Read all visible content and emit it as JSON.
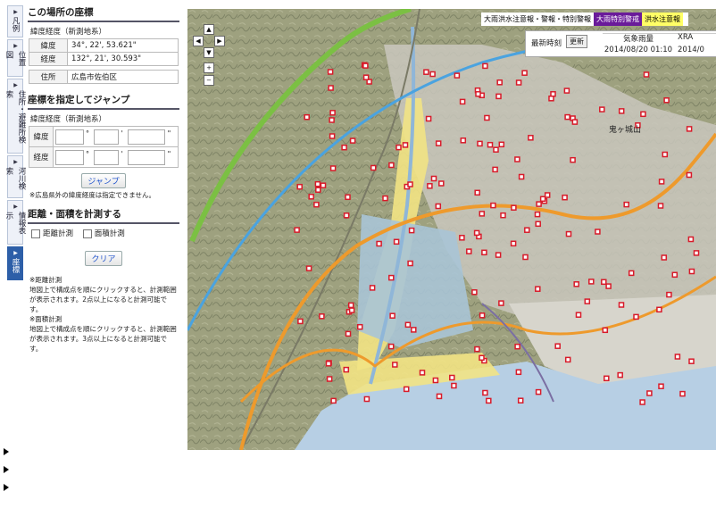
{
  "tabs": [
    {
      "label": "凡例"
    },
    {
      "label": "位置図"
    },
    {
      "label": "住所・避難所検索"
    },
    {
      "label": "河川検索"
    },
    {
      "label": "情報表示"
    },
    {
      "label": "座標"
    }
  ],
  "coord": {
    "title": "この場所の座標",
    "sub": "緯度経度（新測地系）",
    "lat_label": "緯度",
    "lat_value": "34°, 22', 53.621\"",
    "lon_label": "経度",
    "lon_value": "132°, 21', 30.593\"",
    "addr_label": "住所",
    "addr_value": "広島市佐伯区"
  },
  "jump": {
    "title": "座標を指定してジャンプ",
    "sub": "緯度経度（新測地系）",
    "lat_label": "緯度",
    "lon_label": "経度",
    "deg": "°",
    "min": "'",
    "sec": "\"",
    "button": "ジャンプ",
    "note": "※広島県外の緯度経度は指定できません。"
  },
  "measure": {
    "title": "距離・面積を計測する",
    "dist_label": "距離計測",
    "area_label": "面積計測",
    "clear": "クリア",
    "note1_title": "※距離計測",
    "note1": "地図上で構成点を順にクリックすると、計測範囲が表示されます。2点以上になると計測可能です。",
    "note2_title": "※面積計測",
    "note2": "地図上で構成点を順にクリックすると、計測範囲が表示されます。3点以上になると計測可能です。"
  },
  "map": {
    "nav": {
      "up": "▲",
      "left": "◀",
      "right": "▶",
      "down": "▼",
      "zoom_in": "+",
      "zoom_out": "−"
    },
    "legend": [
      {
        "label": "大雨洪水注意報・警報・特別警報",
        "bg": "#ffffff",
        "fg": "#000000"
      },
      {
        "label": "大雨特別警戒",
        "bg": "#6a1b9a",
        "fg": "#ffffff"
      },
      {
        "label": "洪水注意報",
        "bg": "#ffff66",
        "fg": "#000000"
      },
      {
        "label": "",
        "bg": "#ffffff",
        "fg": "#000000"
      }
    ],
    "rain": {
      "latest": "最新時刻",
      "update": "更新",
      "col1": "気象雨量",
      "col2": "XRA",
      "time1": "2014/08/20 01:10",
      "time2": "2014/0"
    },
    "place_label": "鬼ヶ城山"
  }
}
